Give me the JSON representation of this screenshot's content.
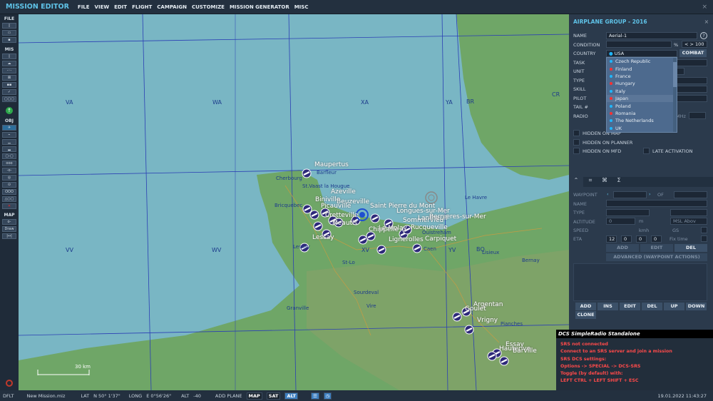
{
  "app": {
    "title": "MISSION EDITOR",
    "menu": [
      "FILE",
      "VIEW",
      "EDIT",
      "FLIGHT",
      "CAMPAIGN",
      "CUSTOMIZE",
      "MISSION GENERATOR",
      "MISC"
    ],
    "close": "×"
  },
  "toolbar": {
    "sections": [
      "FILE",
      "MIS",
      "OBJ",
      "MAP"
    ],
    "draw": "Draw"
  },
  "map": {
    "grid": [
      "VA",
      "WA",
      "XA",
      "YA",
      "BR",
      "CR",
      "VV",
      "WV",
      "XV",
      "YV",
      "BQ"
    ],
    "towns": [
      "Maupertus",
      "Azeville",
      "Beuzeville",
      "Biniville",
      "Picauville",
      "Cretteville",
      "Meautis",
      "Lessay",
      "Saint Pierre du Mont",
      "Longues-sur-Mer",
      "Sommervieu",
      "Le Molay",
      "Chippelle",
      "Rucqueville",
      "Lantheuil",
      "Lignerolles",
      "Carpiquet",
      "Argentan",
      "Goulet",
      "Vrigny",
      "Essay",
      "Hauterive",
      "Barville",
      "Bernieres-sur-Mer"
    ],
    "places": [
      "Barfleur",
      "Cherbourg",
      "St.Vaast la Hougue",
      "Bricquebec",
      "Le Havre",
      "Lisieux",
      "Bernay",
      "Caen",
      "Ouistreham",
      "St-Lo",
      "Sourdeval",
      "Vire",
      "Granville",
      "Pianches",
      "Lessay"
    ],
    "scale": "30 km",
    "colors": {
      "sea": "#79b6c4",
      "land": "#6fa667",
      "grid": "#2b3fb4"
    }
  },
  "panel": {
    "title": "AIRPLANE GROUP - 2016",
    "close": "×",
    "labels": [
      "NAME",
      "CONDITION",
      "COUNTRY",
      "TASK",
      "UNIT",
      "TYPE",
      "SKILL",
      "PILOT",
      "TAIL #",
      "RADIO"
    ],
    "name": "Aerial-1",
    "help": "?",
    "condition_unit": "%",
    "condition_value": "100",
    "stepper": "< >",
    "country": "USA",
    "combat": "COMBAT",
    "mhz": "MHz",
    "countries": [
      {
        "name": "Czech Republic",
        "color": "#1fb7ff"
      },
      {
        "name": "Finland",
        "color": "#ff3030"
      },
      {
        "name": "France",
        "color": "#1fb7ff"
      },
      {
        "name": "Hungary",
        "color": "#ff3030"
      },
      {
        "name": "Italy",
        "color": "#1fb7ff"
      },
      {
        "name": "Japan",
        "color": "#ff3030"
      },
      {
        "name": "Poland",
        "color": "#1fb7ff"
      },
      {
        "name": "Romania",
        "color": "#ff3030"
      },
      {
        "name": "The Netherlands",
        "color": "#1fb7ff"
      },
      {
        "name": "UK",
        "color": "#1fb7ff"
      }
    ],
    "highlighted": "Japan",
    "checks": [
      "HIDDEN ON MAP",
      "HIDDEN ON PLANNER",
      "HIDDEN ON MFD",
      "LATE ACTIVATION"
    ],
    "waypoint": {
      "labels": [
        "WAYPOINT",
        "NAME",
        "TYPE",
        "ALTITUDE",
        "SPEED",
        "ETA"
      ],
      "of": "OF",
      "alt_unit": "m",
      "alt_value": "0",
      "msl": "MSL",
      "above": "Abov",
      "speed_unit": "kmh",
      "gs": "GS",
      "eta": [
        "12",
        "0",
        "0",
        "0"
      ],
      "fix": "Fix time",
      "buttons": [
        "ADD",
        "EDIT",
        "DEL"
      ],
      "advanced": "ADVANCED (WAYPOINT ACTIONS)",
      "list_buttons": [
        "ADD",
        "INS",
        "EDIT",
        "DEL",
        "UP",
        "DOWN",
        "CLONE"
      ]
    }
  },
  "srs": {
    "title": "DCS SimpleRadio Standalone",
    "lines": [
      "SRS not connected",
      "Connect to an SRS server and join a mission",
      "SRS DCS settings:",
      "Options -> SPECIAL -> DCS-SRS",
      "Toggle (by default) with:",
      "LEFT CTRL + LEFT SHIFT + ESC"
    ]
  },
  "status": {
    "profile": "DFLT",
    "file": "New Mission.miz",
    "lat_label": "LAT",
    "lat": "N 50° 1'37\"",
    "long_label": "LONG",
    "long": "E  0°56'26\"",
    "alt_label": "ALT",
    "alt": "-40",
    "add": "ADD PLANE",
    "map": "MAP",
    "sat": "SAT",
    "alt_btn": "ALT",
    "datetime": "19.01.2022 11:43:27"
  }
}
